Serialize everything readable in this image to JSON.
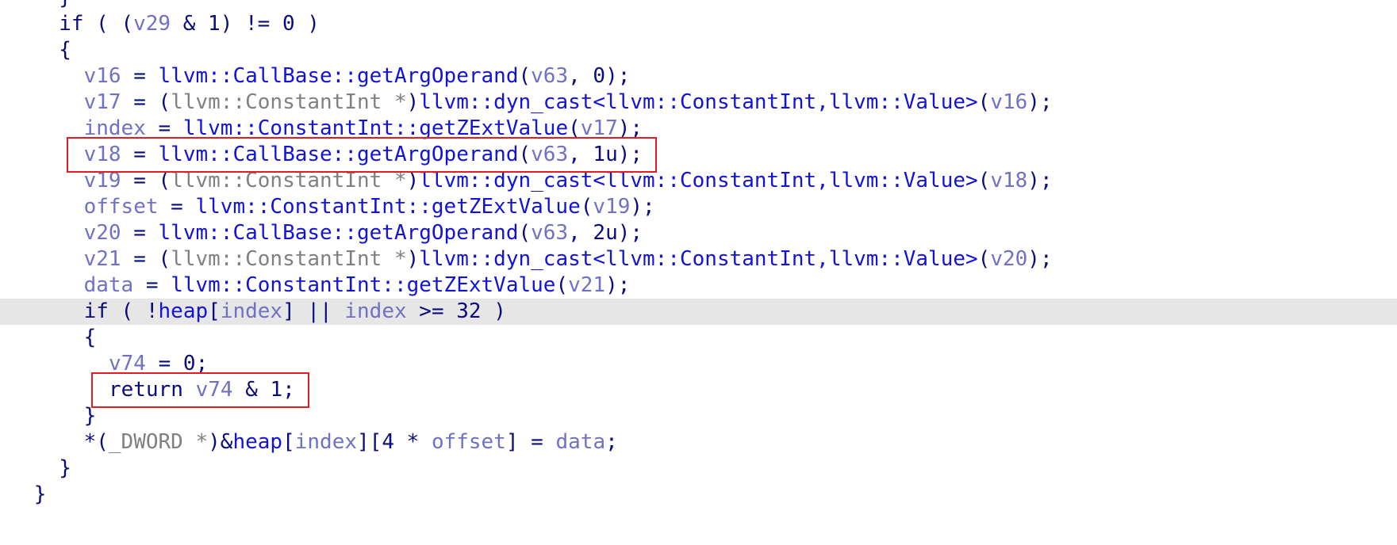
{
  "editor": {
    "indent_unit": 2,
    "colors": {
      "keyword": "#0b0b7a",
      "plain": "#0b0b7a",
      "variable": "#7070c4",
      "function": "#1212d8",
      "type": "#808080",
      "number": "#0b0b7a",
      "current_line_bg": "#e6e6e6",
      "highlight_box": "#e51b23"
    },
    "highlighted_lines": [
      6,
      15
    ],
    "current_line": 12,
    "lines": [
      {
        "indent": 3,
        "tokens": [
          [
            "}",
            "pl"
          ]
        ]
      },
      {
        "indent": 3,
        "tokens": [
          [
            "if",
            "kw"
          ],
          [
            " ( (",
            "pl"
          ],
          [
            "v29",
            "var"
          ],
          [
            " & 1) != 0 )",
            "pl"
          ]
        ]
      },
      {
        "indent": 3,
        "tokens": [
          [
            "{",
            "pl"
          ]
        ]
      },
      {
        "indent": 4,
        "tokens": [
          [
            "v16",
            "var"
          ],
          [
            " = ",
            "pl"
          ],
          [
            "llvm::CallBase::getArgOperand",
            "fn"
          ],
          [
            "(",
            "pl"
          ],
          [
            "v63",
            "var"
          ],
          [
            ", 0);",
            "pl"
          ]
        ]
      },
      {
        "indent": 4,
        "tokens": [
          [
            "v17",
            "var"
          ],
          [
            " = (",
            "pl"
          ],
          [
            "llvm::ConstantInt *",
            "ty"
          ],
          [
            ")",
            "pl"
          ],
          [
            "llvm::dyn_cast<llvm::ConstantInt,llvm::Value>",
            "fn"
          ],
          [
            "(",
            "pl"
          ],
          [
            "v16",
            "var"
          ],
          [
            ");",
            "pl"
          ]
        ]
      },
      {
        "indent": 4,
        "tokens": [
          [
            "index",
            "var"
          ],
          [
            " = ",
            "pl"
          ],
          [
            "llvm::ConstantInt::getZExtValue",
            "fn"
          ],
          [
            "(",
            "pl"
          ],
          [
            "v17",
            "var"
          ],
          [
            ");",
            "pl"
          ]
        ]
      },
      {
        "indent": 4,
        "tokens": [
          [
            "v18",
            "var"
          ],
          [
            " = ",
            "pl"
          ],
          [
            "llvm::CallBase::getArgOperand",
            "fn"
          ],
          [
            "(",
            "pl"
          ],
          [
            "v63",
            "var"
          ],
          [
            ", 1u);",
            "pl"
          ]
        ]
      },
      {
        "indent": 4,
        "tokens": [
          [
            "v19",
            "var"
          ],
          [
            " = (",
            "pl"
          ],
          [
            "llvm::ConstantInt *",
            "ty"
          ],
          [
            ")",
            "pl"
          ],
          [
            "llvm::dyn_cast<llvm::ConstantInt,llvm::Value>",
            "fn"
          ],
          [
            "(",
            "pl"
          ],
          [
            "v18",
            "var"
          ],
          [
            ");",
            "pl"
          ]
        ]
      },
      {
        "indent": 4,
        "tokens": [
          [
            "offset",
            "var"
          ],
          [
            " = ",
            "pl"
          ],
          [
            "llvm::ConstantInt::getZExtValue",
            "fn"
          ],
          [
            "(",
            "pl"
          ],
          [
            "v19",
            "var"
          ],
          [
            ");",
            "pl"
          ]
        ]
      },
      {
        "indent": 4,
        "tokens": [
          [
            "v20",
            "var"
          ],
          [
            " = ",
            "pl"
          ],
          [
            "llvm::CallBase::getArgOperand",
            "fn"
          ],
          [
            "(",
            "pl"
          ],
          [
            "v63",
            "var"
          ],
          [
            ", 2u);",
            "pl"
          ]
        ]
      },
      {
        "indent": 4,
        "tokens": [
          [
            "v21",
            "var"
          ],
          [
            " = (",
            "pl"
          ],
          [
            "llvm::ConstantInt *",
            "ty"
          ],
          [
            ")",
            "pl"
          ],
          [
            "llvm::dyn_cast<llvm::ConstantInt,llvm::Value>",
            "fn"
          ],
          [
            "(",
            "pl"
          ],
          [
            "v20",
            "var"
          ],
          [
            ");",
            "pl"
          ]
        ]
      },
      {
        "indent": 4,
        "tokens": [
          [
            "data",
            "var"
          ],
          [
            " = ",
            "pl"
          ],
          [
            "llvm::ConstantInt::getZExtValue",
            "fn"
          ],
          [
            "(",
            "pl"
          ],
          [
            "v21",
            "var"
          ],
          [
            ");",
            "pl"
          ]
        ]
      },
      {
        "indent": 4,
        "tokens": [
          [
            "if",
            "kw"
          ],
          [
            " ( !",
            "pl"
          ],
          [
            "heap",
            "fn"
          ],
          [
            "[",
            "pl"
          ],
          [
            "index",
            "var"
          ],
          [
            "] || ",
            "pl"
          ],
          [
            "index",
            "var"
          ],
          [
            " >= 32 )",
            "pl"
          ]
        ]
      },
      {
        "indent": 4,
        "tokens": [
          [
            "{",
            "pl"
          ]
        ]
      },
      {
        "indent": 5,
        "tokens": [
          [
            "v74",
            "var"
          ],
          [
            " = 0;",
            "pl"
          ]
        ]
      },
      {
        "indent": 5,
        "tokens": [
          [
            "return",
            "kw"
          ],
          [
            " ",
            "pl"
          ],
          [
            "v74",
            "var"
          ],
          [
            " & 1;",
            "pl"
          ]
        ]
      },
      {
        "indent": 4,
        "tokens": [
          [
            "}",
            "pl"
          ]
        ]
      },
      {
        "indent": 4,
        "tokens": [
          [
            "*(",
            "pl"
          ],
          [
            "_DWORD *",
            "ty"
          ],
          [
            ")&",
            "pl"
          ],
          [
            "heap",
            "fn"
          ],
          [
            "[",
            "pl"
          ],
          [
            "index",
            "var"
          ],
          [
            "][4 * ",
            "pl"
          ],
          [
            "offset",
            "var"
          ],
          [
            "] = ",
            "pl"
          ],
          [
            "data",
            "var"
          ],
          [
            ";",
            "pl"
          ]
        ]
      },
      {
        "indent": 3,
        "tokens": [
          [
            "}",
            "pl"
          ]
        ]
      },
      {
        "indent": 2,
        "tokens": [
          [
            "}",
            "pl"
          ]
        ]
      }
    ]
  }
}
